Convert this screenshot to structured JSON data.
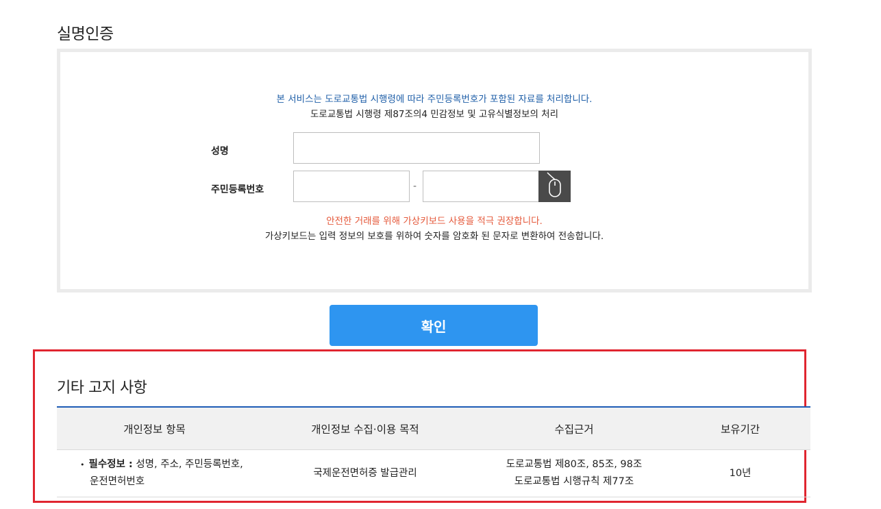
{
  "page": {
    "title": "실명인증"
  },
  "auth_box": {
    "notice_blue": "본 서비스는 도로교통법 시행령에 따라 주민등록번호가 포함된 자료를 처리합니다.",
    "notice_black": "도로교통법 시행령 제87조의4 민감정보 및 고유식별정보의 처리",
    "name_label": "성명",
    "name_value": "",
    "rrn_label": "주민등록번호",
    "rrn_front_value": "",
    "rrn_separator": "-",
    "rrn_back_value": "",
    "virtual_keyboard_icon": "mouse-icon",
    "warning_red": "안전한 거래를 위해 가상키보드 사용을 적극 권장합니다.",
    "warning_black": "가상키보드는 입력 정보의 보호를 위하여 숫자를 암호화 된 문자로 변환하여 전송합니다."
  },
  "confirm_button": {
    "label": "확인"
  },
  "notice_section": {
    "title": "기타 고지 사항",
    "columns": [
      "개인정보 항목",
      "개인정보 수집·이용 목적",
      "수집근거",
      "보유기간"
    ],
    "row": {
      "bullet": "•",
      "item_label": "필수정보 :",
      "item_line1": " 성명, 주소, 주민등록번호,",
      "item_line2": "운전면허번호",
      "purpose": "국제운전면허증 발급관리",
      "basis_line1": "도로교통법 제80조, 85조, 98조",
      "basis_line2": "도로교통법 시행규칙 제77조",
      "retention": "10년"
    }
  },
  "colors": {
    "accent_blue": "#2e95f0",
    "notice_blue": "#1f5fa8",
    "warning_red": "#e55a3c",
    "highlight_red": "#e0252f",
    "table_top_border": "#1d5bb5"
  }
}
